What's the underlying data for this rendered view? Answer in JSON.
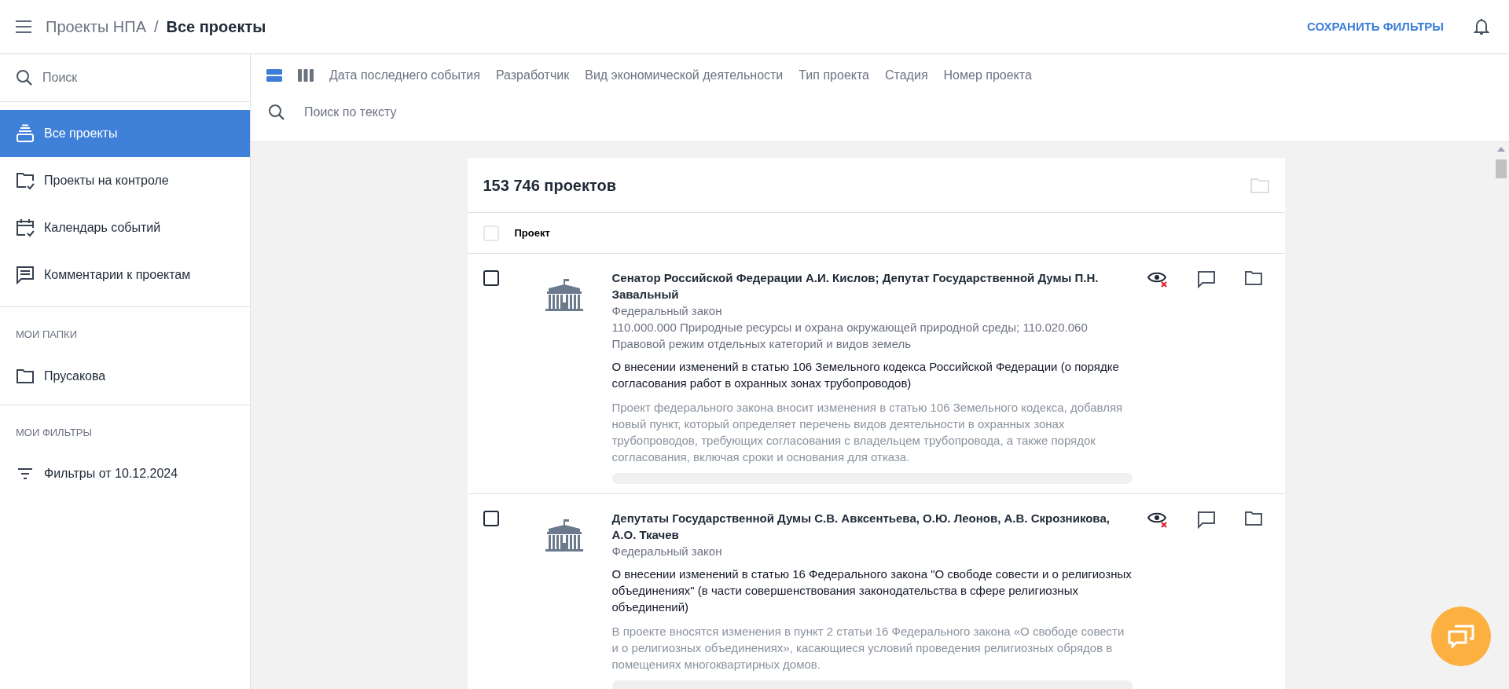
{
  "header": {
    "breadcrumb_parent": "Проекты НПА",
    "separator": "/",
    "breadcrumb_current": "Все проекты",
    "save_filters": "СОХРАНИТЬ ФИЛЬТРЫ"
  },
  "sidebar": {
    "search_placeholder": "Поиск",
    "nav": [
      {
        "kind": "stack",
        "label": "Все проекты",
        "selected": true
      },
      {
        "kind": "folder-check",
        "label": "Проекты на контроле",
        "selected": false
      },
      {
        "kind": "calendar",
        "label": "Календарь событий",
        "selected": false
      },
      {
        "kind": "comment",
        "label": "Комментарии к проектам",
        "selected": false
      }
    ],
    "folders_title": "МОИ ПАПКИ",
    "folders": [
      {
        "label": "Прусакова"
      }
    ],
    "filters_title": "МОИ ФИЛЬТРЫ",
    "filters": [
      {
        "label": "Фильтры от 10.12.2024"
      }
    ]
  },
  "filter_bar": {
    "views": [
      {
        "kind": "rows",
        "selected": true
      },
      {
        "kind": "columns",
        "selected": false
      }
    ],
    "filters": [
      "Дата последнего события",
      "Разработчик",
      "Вид экономической деятельности",
      "Тип проекта",
      "Стадия",
      "Номер проекта"
    ],
    "text_search_placeholder": "Поиск по тексту"
  },
  "list": {
    "count": "153 746 проектов",
    "column": "Проект",
    "select_all": false,
    "projects": [
      {
        "checked": false,
        "authors": "Сенатор Российской Федерации А.И. Кислов; Депутат Государственной Думы П.Н. Завальный",
        "type": "Федеральный закон",
        "category": "110.000.000 Природные ресурсы и охрана окружающей природной среды; 110.020.060 Правовой режим отдельных категорий и видов земель",
        "title": "О внесении изменений в статью 106 Земельного кодекса Российской Федерации (о порядке согласования работ в охранных зонах трубопроводов)",
        "summary": "Проект федерального закона вносит изменения в статью 106 Земельного кодекса, добавляя новый пункт, который определяет перечень видов деятельности в охранных зонах трубопроводов, требующих согласования с владельцем трубопровода, а также порядок согласования, включая сроки и основания для отказа."
      },
      {
        "checked": false,
        "authors": "Депутаты Государственной Думы С.В. Авксентьева, О.Ю. Леонов, А.В. Скрозникова, А.О. Ткачев",
        "type": "Федеральный закон",
        "title": "О внесении изменений в статью 16 Федерального закона \"О свободе совести и о религиозных объединениях\" (в части совершенствования законодательства в сфере религиозных объединений)",
        "summary": "В проекте вносятся изменения в пункт 2 статьи 16 Федерального закона «О свободе совести и о религиозных объединениях», касающиеся условий проведения религиозных обрядов в помещениях многоквартирных домов."
      }
    ]
  }
}
